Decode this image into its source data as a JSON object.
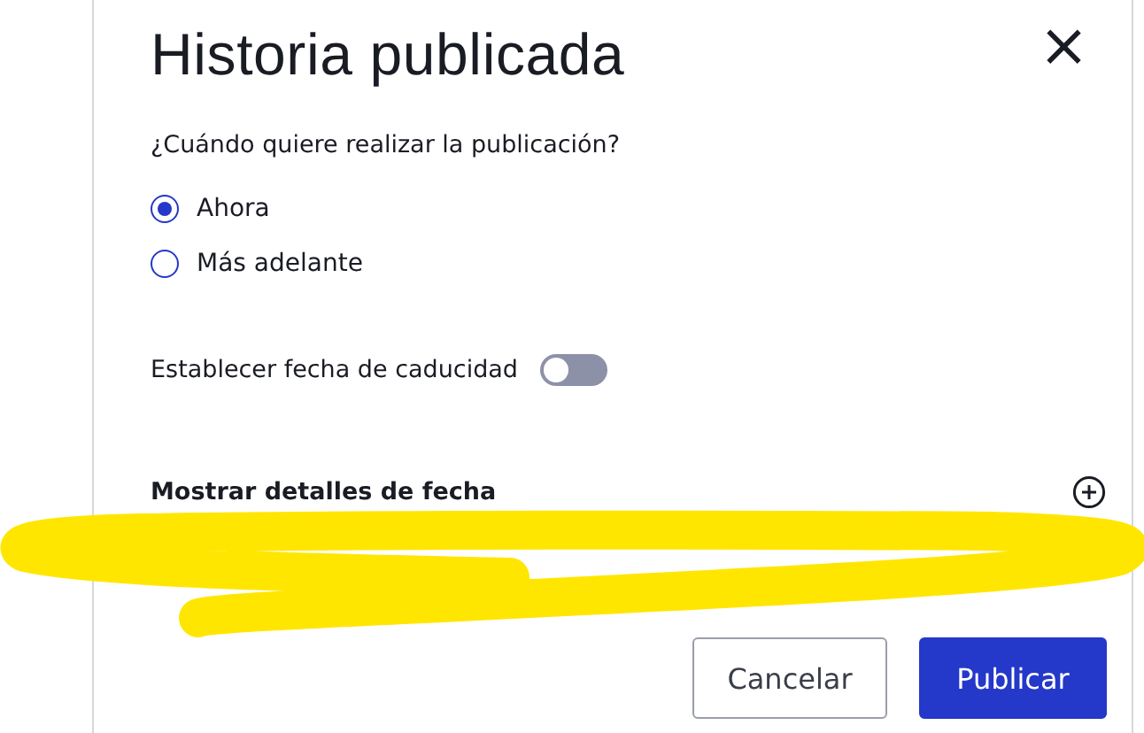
{
  "dialog": {
    "title": "Historia publicada",
    "close": "×"
  },
  "question": "¿Cuándo quiere realizar la publicación?",
  "options": [
    {
      "label": "Ahora",
      "selected": true
    },
    {
      "label": "Más adelante",
      "selected": false
    }
  ],
  "expiry": {
    "label": "Establecer fecha de caducidad",
    "on": false
  },
  "details": {
    "label": "Mostrar detalles de fecha",
    "expanded": false
  },
  "buttons": [
    {
      "label": "Cancelar",
      "kind": "secondary"
    },
    {
      "label": "Publicar",
      "kind": "primary"
    }
  ]
}
